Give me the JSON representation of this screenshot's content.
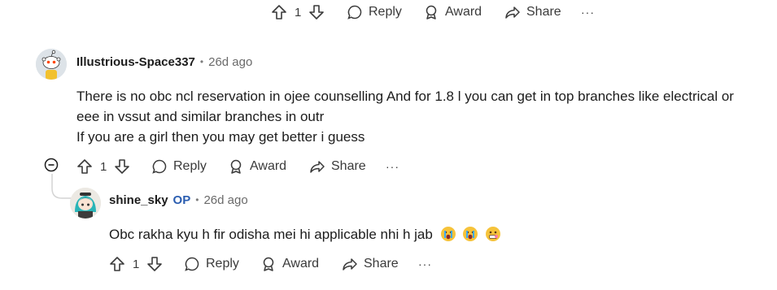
{
  "top_actions": {
    "vote_count": "1",
    "reply": "Reply",
    "award": "Award",
    "share": "Share",
    "more": "···"
  },
  "comment1": {
    "username": "Illustrious-Space337",
    "separator": "•",
    "time": "26d ago",
    "text_line1": "There is no obc ncl reservation in ojee counselling And for 1.8 l you can get in top branches like electrical or",
    "text_line2": "eee in vssut and similar branches in outr",
    "text_line3": "If you are a girl then you may get better i guess",
    "vote_count": "1",
    "reply": "Reply",
    "award": "Award",
    "share": "Share",
    "more": "···"
  },
  "comment2": {
    "username": "shine_sky",
    "op_badge": "OP",
    "separator": "•",
    "time": "26d ago",
    "text": "Obc rakha kyu h fir odisha mei hi applicable nhi h jab",
    "emojis": [
      "crying-face-emoji",
      "crying-face-emoji",
      "grimacing-face-emoji"
    ],
    "vote_count": "1",
    "reply": "Reply",
    "award": "Award",
    "share": "Share",
    "more": "···"
  },
  "colors": {
    "text": "#1c1c1c",
    "muted": "#6a6a6a",
    "op_blue": "#2a5db0",
    "thread_line": "#d4d4d4"
  }
}
